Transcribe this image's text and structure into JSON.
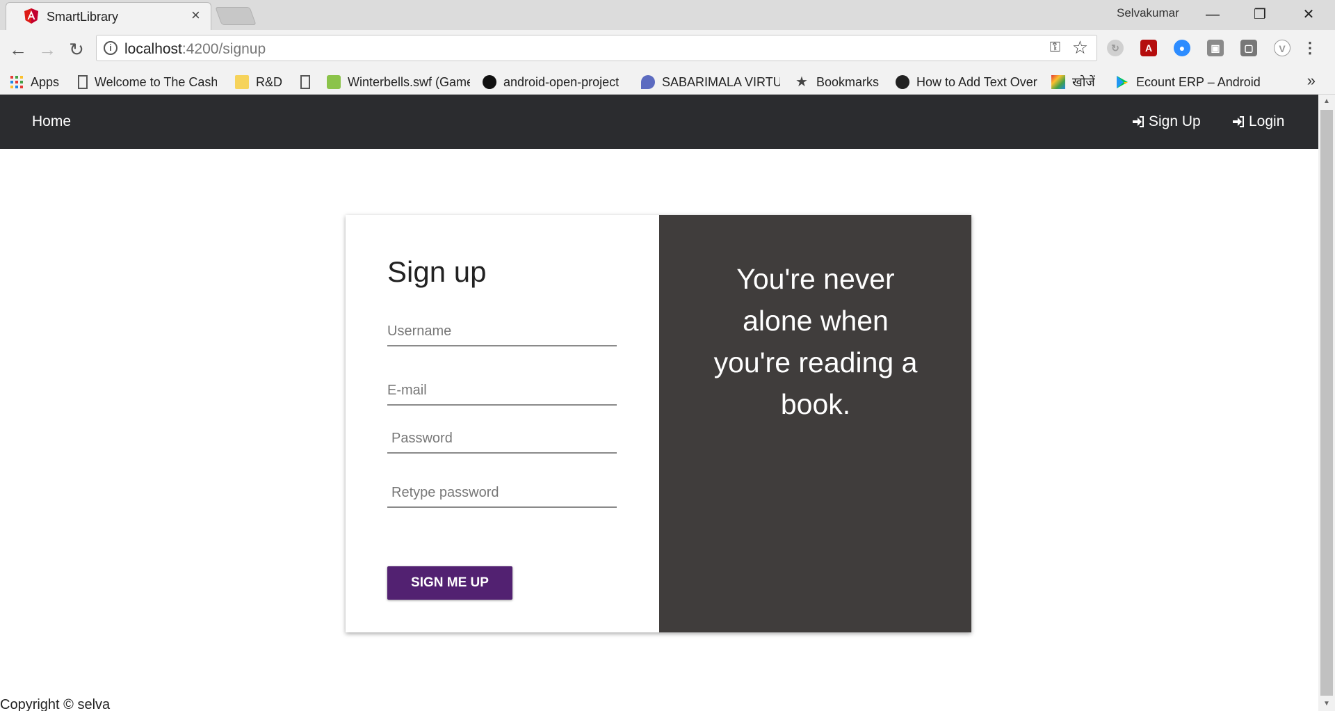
{
  "browser": {
    "tab_title": "SmartLibrary",
    "tab_close": "×",
    "profile_name": "Selvakumar",
    "window_controls": {
      "minimize": "—",
      "restore": "❐",
      "close": "✕"
    },
    "url_host": "localhost",
    "url_rest": ":4200/signup",
    "bookmarks": [
      {
        "label": "Apps",
        "icon": "apps-grid-icon"
      },
      {
        "label": "Welcome to The Cash",
        "icon": "page-icon"
      },
      {
        "label": "R&D",
        "icon": "folder-icon"
      },
      {
        "label": "",
        "icon": "page-icon"
      },
      {
        "label": "Winterbells.swf (Game",
        "icon": "game-icon"
      },
      {
        "label": "android-open-project",
        "icon": "github-icon"
      },
      {
        "label": "SABARIMALA VIRTUAL",
        "icon": "location-icon"
      },
      {
        "label": "Bookmarks",
        "icon": "star-icon"
      },
      {
        "label": "How to Add Text Over",
        "icon": "pie-icon"
      },
      {
        "label": "खोजें",
        "icon": "colorful-icon"
      },
      {
        "label": "Ecount ERP – Android",
        "icon": "play-store-icon"
      }
    ],
    "more_bookmarks": "»"
  },
  "navbar": {
    "home": "Home",
    "signup": "Sign Up",
    "login": "Login"
  },
  "form": {
    "title": "Sign up",
    "username_placeholder": "Username",
    "email_placeholder": "E-mail",
    "password_placeholder": "Password",
    "retype_placeholder": "Retype password",
    "submit_label": "SIGN ME UP"
  },
  "quote": "You're never alone when you're reading a book.",
  "footer": "Copyright © selva",
  "colors": {
    "navbar": "#2b2c2f",
    "quote_panel": "#403d3c",
    "button": "#522171"
  }
}
